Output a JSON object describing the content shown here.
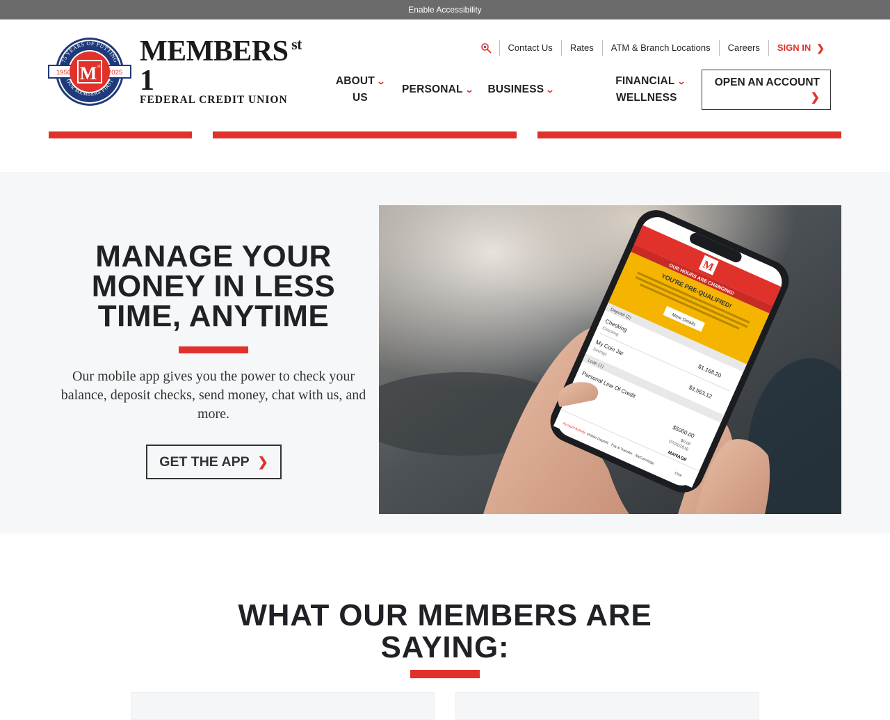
{
  "accessibility_bar": {
    "label": "Enable Accessibility"
  },
  "logo": {
    "seal_top_text": "75 YEARS OF PUTTING",
    "seal_bottom_text": "OUR MEMBERS FIRST",
    "seal_year_left": "1950",
    "seal_year_right": "2025",
    "seal_letter": "M",
    "seal_sup": "st",
    "name": "MEMBERS 1",
    "name_sup": "st",
    "subtitle": "FEDERAL CREDIT UNION"
  },
  "utility_nav": {
    "search_icon": "search-icon",
    "items": [
      "Contact Us",
      "Rates",
      "ATM & Branch Locations",
      "Careers"
    ],
    "sign_in": "SIGN IN"
  },
  "main_nav": {
    "about": {
      "line1": "ABOUT",
      "line2": "US"
    },
    "personal": "PERSONAL",
    "business": "BUSINESS",
    "financial": {
      "line1": "FINANCIAL",
      "line2": "WELLNESS"
    },
    "open_account": "OPEN AN ACCOUNT"
  },
  "hero": {
    "title_line1": "MANAGE YOUR",
    "title_line2": "MONEY IN LESS",
    "title_line3": "TIME, ANYTIME",
    "body": "Our mobile app gives you the power to check your balance, deposit checks, send money, chat with us, and more.",
    "button": "GET THE APP",
    "phone_screen": {
      "banner": "OUR HOURS ARE CHANGING!",
      "promo_title": "YOU'RE PRE-QUALIFIED!",
      "promo_text": "Congratulations! You're pre-qualified for a Home Equity Freedom Line of Credit that provides a reserve of funds available to you whenever needed.",
      "promo_button": "More Details",
      "section_deposit": "Deposit (2)",
      "acct1_name": "Checking",
      "acct1_sub": "Checking",
      "acct1_amount": "$1,168.20",
      "acct2_name": "My Coin Jar",
      "acct2_sub": "Savings",
      "acct2_amount": "$3,563.12",
      "section_loan": "Loan (1)",
      "acct3_name": "Personal Line Of Credit",
      "acct3_amount": "$5000.00",
      "acct3_due": "$0.00",
      "acct3_date": "07/31/2019",
      "manage": "MANAGE",
      "tabs": [
        "Account Activity",
        "Mobile Deposit",
        "Pay & Transfer",
        "MyConcierge",
        "Chat"
      ]
    }
  },
  "testimonials": {
    "title_line1": "WHAT OUR MEMBERS ARE",
    "title_line2": "SAYING:"
  },
  "colors": {
    "brand_red": "#e0312b",
    "navy": "#1f3a7a",
    "dark_text": "#1f2126",
    "hero_bg": "#f6f7f8"
  }
}
